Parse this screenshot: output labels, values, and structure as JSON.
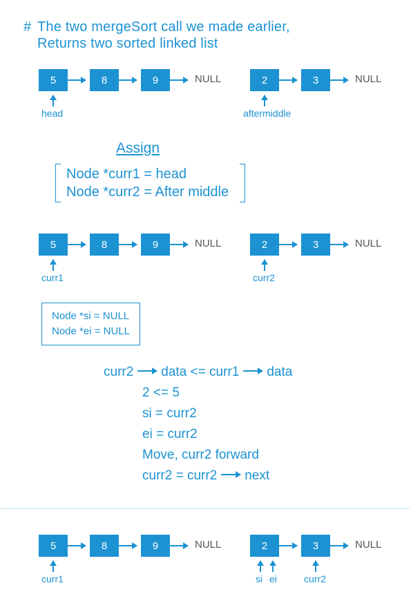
{
  "header": {
    "hash": "#",
    "line1": "The two mergeSort call we made earlier,",
    "line2": "Returns two sorted linked list"
  },
  "null_text": "NULL",
  "list1": {
    "nodes": [
      "5",
      "8",
      "9"
    ]
  },
  "list2": {
    "nodes": [
      "2",
      "3"
    ]
  },
  "row1_labels": {
    "left": "head",
    "right": "aftermiddle"
  },
  "assign_heading": "Assign",
  "assign_code": {
    "l1": "Node *curr1 = head",
    "l2": "Node *curr2 = After middle"
  },
  "row2_labels": {
    "left": "curr1",
    "right": "curr2"
  },
  "small_box": {
    "l1": "Node *si = NULL",
    "l2": "Node *ei = NULL"
  },
  "logic": {
    "line1_a": "curr2",
    "line1_b": "data  <=   curr1",
    "line1_c": "data",
    "line2": "2  <=  5",
    "line3": "si  =  curr2",
    "line4": "ei  =  curr2",
    "line5": "Move,  curr2  forward",
    "line6_a": "curr2 = curr2",
    "line6_b": "next"
  },
  "row3_labels": {
    "left": "curr1",
    "si": "si",
    "ei": "ei",
    "right": "curr2"
  }
}
